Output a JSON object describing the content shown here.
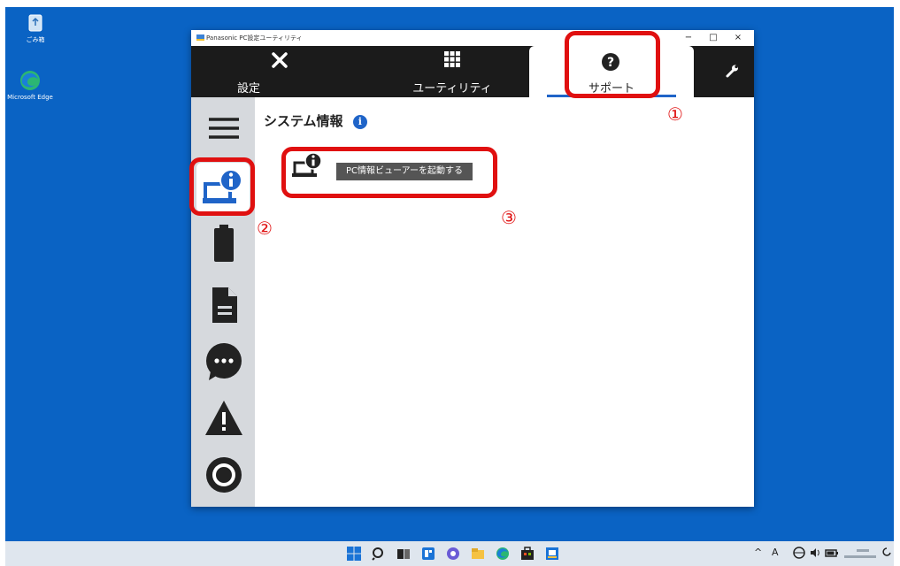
{
  "desktop": {
    "icons": [
      {
        "label": "ごみ箱",
        "icon": "recycle-bin-icon"
      },
      {
        "label": "Microsoft Edge",
        "icon": "edge-icon"
      }
    ]
  },
  "window": {
    "title": "Panasonic PC設定ユーティリティ",
    "controls": {
      "minimize": "−",
      "maximize": "□",
      "close": "×"
    }
  },
  "tabs": [
    {
      "label": "設定",
      "icon": "tools-icon"
    },
    {
      "label": "ユーティリティ",
      "icon": "grid-icon"
    },
    {
      "label": "サポート",
      "icon": "help-icon",
      "active": true
    },
    {
      "label": "",
      "icon": "wrench-icon"
    }
  ],
  "sidebar": {
    "items": [
      {
        "icon": "menu-icon"
      },
      {
        "icon": "system-info-icon",
        "selected": true
      },
      {
        "icon": "battery-icon"
      },
      {
        "icon": "document-icon"
      },
      {
        "icon": "chat-icon"
      },
      {
        "icon": "warning-icon"
      },
      {
        "icon": "ring-icon"
      }
    ]
  },
  "content": {
    "title": "システム情報",
    "info_glyph": "i",
    "launch_button": "PC情報ビューアーを起動する"
  },
  "annotations": {
    "callout_1": "①",
    "callout_2": "②",
    "callout_3": "③",
    "color": "#e01010"
  },
  "taskbar": {
    "apps": [
      "start-icon",
      "search-icon",
      "task-view-icon",
      "widgets-icon",
      "chat-icon",
      "explorer-icon",
      "edge-icon",
      "store-icon",
      "pc-settings-icon"
    ],
    "tray": {
      "chevron": "^",
      "ime": "A"
    }
  },
  "colors": {
    "desktop": "#0a63c4",
    "accent": "#1f64c8",
    "tabbar": "#1b1b1b",
    "sidebar": "#d6d9dd"
  }
}
